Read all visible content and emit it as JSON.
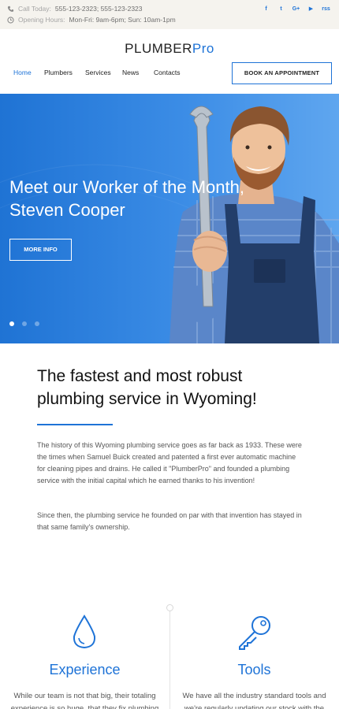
{
  "topbar": {
    "call_label": "Call Today:",
    "call_value": "555-123-2323;  555-123-2323",
    "hours_label": "Opening Hours:",
    "hours_value": "Mon-Fri: 9am-6pm; Sun: 10am-1pm",
    "social": [
      {
        "icon": "facebook-icon",
        "glyph": "f"
      },
      {
        "icon": "twitter-icon",
        "glyph": "t"
      },
      {
        "icon": "google-plus-icon",
        "glyph": "G+"
      },
      {
        "icon": "youtube-icon",
        "glyph": "▶"
      },
      {
        "icon": "rss-icon",
        "glyph": "rss"
      }
    ]
  },
  "header": {
    "logo_part1": "PLUMBER",
    "logo_part2": "Pro",
    "nav": [
      "Home",
      "Plumbers",
      "Services",
      "News",
      "Contacts"
    ],
    "book_button": "BOOK AN APPOINTMENT"
  },
  "hero": {
    "title": "Meet our Worker of the Month, Steven Cooper",
    "button": "MORE INFO",
    "slides_total": 3,
    "active_slide": 1
  },
  "intro": {
    "title": "The fastest and most robust plumbing service in Wyoming!",
    "paragraph1": "The history of this Wyoming plumbing service goes as far back as 1933. These were the times when Samuel Buick created and patented a first ever automatic machine for cleaning pipes and drains. He called it \"PlumberPro\" and founded a plumbing service with the initial capital which he earned thanks to his invention!",
    "paragraph2": "Since then, the plumbing service he founded on par with that invention has stayed in that same family's ownership."
  },
  "features": [
    {
      "icon": "water-drop-icon",
      "title": "Experience",
      "text": "While our team is not that big, their totaling experience is so huge, that they fix plumbing"
    },
    {
      "icon": "key-icon",
      "title": "Tools",
      "text": "We have all the industry standard tools and we're regularly updating our stock with the"
    }
  ],
  "colors": {
    "accent": "#1e73d7",
    "topbar_bg": "#f5f3ee",
    "hero_bg": "#2c7fde"
  }
}
